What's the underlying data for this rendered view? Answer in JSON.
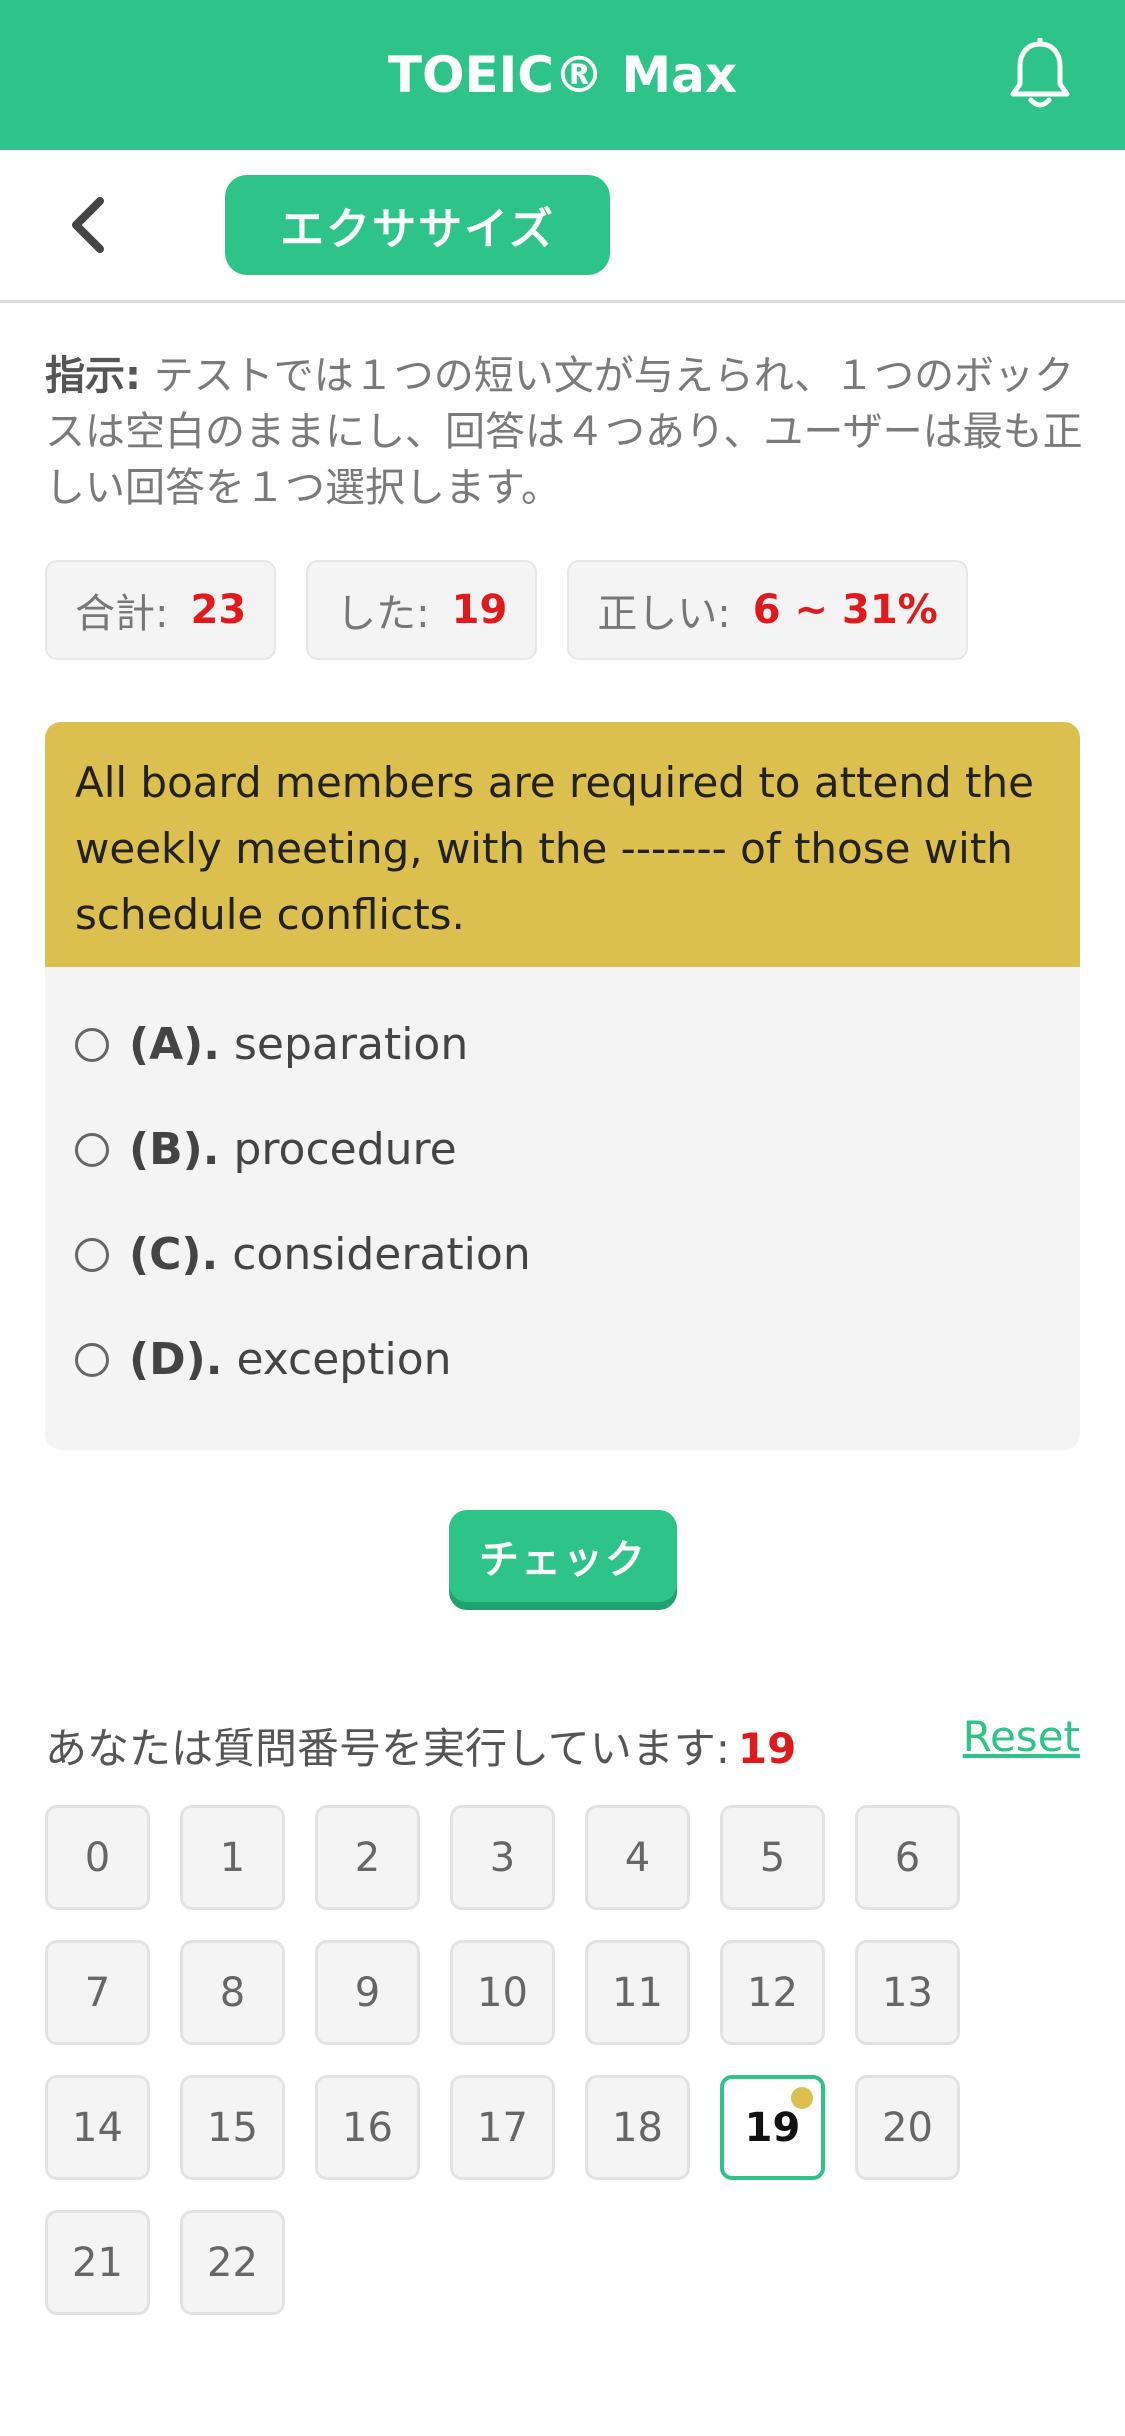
{
  "header": {
    "title": "TOEIC® Max",
    "icon": "bell-icon"
  },
  "subheader": {
    "back_icon": "chevron-left-icon",
    "tab_label": "エクササイズ"
  },
  "instructions": {
    "label": "指示:",
    "text": " テストでは１つの短い文が与えられ、１つのボックスは空白のままにし、回答は４つあり、ユーザーは最も正しい回答を１つ選択します。"
  },
  "stats": {
    "total_label": "合計:",
    "total_value": "23",
    "done_label": "した:",
    "done_value": "19",
    "correct_label": "正しい:",
    "correct_value": "6 ~ 31%"
  },
  "question": {
    "text": "All board members are required to attend the weekly meeting, with the ------- of those with schedule conflicts.",
    "options": [
      {
        "letter": "(A).",
        "text": "separation"
      },
      {
        "letter": "(B).",
        "text": "procedure"
      },
      {
        "letter": "(C).",
        "text": "consideration"
      },
      {
        "letter": "(D).",
        "text": "exception"
      }
    ]
  },
  "check_label": "チェック",
  "progress": {
    "label": "あなたは質問番号を実行しています:",
    "current": "19",
    "reset_label": "Reset"
  },
  "numbers": [
    "0",
    "1",
    "2",
    "3",
    "4",
    "5",
    "6",
    "7",
    "8",
    "9",
    "10",
    "11",
    "12",
    "13",
    "14",
    "15",
    "16",
    "17",
    "18",
    "19",
    "20",
    "21",
    "22"
  ],
  "current_index": 19,
  "colors": {
    "primary": "#2ec489",
    "question_bg": "#dcc04f",
    "highlight": "#e01a1a"
  }
}
